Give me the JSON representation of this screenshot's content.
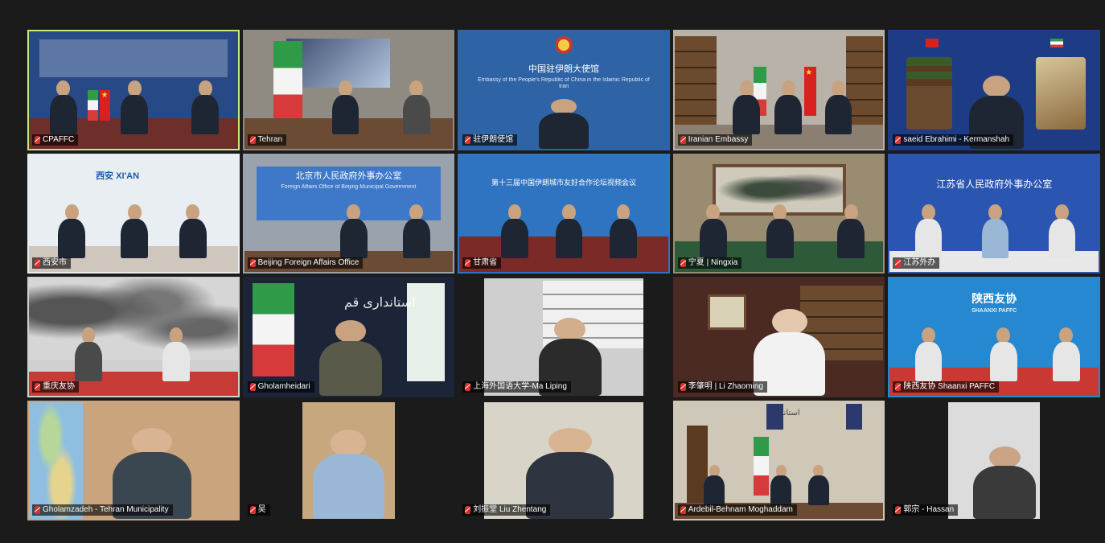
{
  "tiles": [
    {
      "label": "CPAFFC",
      "bg": "#274a86",
      "active": true
    },
    {
      "label": "Tehran",
      "bg": "#8f8a82"
    },
    {
      "label": "驻伊朗使馆",
      "bg": "#2e63a5",
      "sign_title": "中国驻伊朗大使馆",
      "sign_sub": "Embassy of the People's Republic of China in the Islamic Republic of Iran"
    },
    {
      "label": "Iranian Embassy",
      "bg": "#b8b2a8"
    },
    {
      "label": "saeid Ebrahimi - Kermanshah",
      "bg": "#1e3b86"
    },
    {
      "label": "西安市",
      "bg": "#e9eef2",
      "logo": "西安 XI'AN"
    },
    {
      "label": "Beijing Foreign Affairs Office",
      "bg": "#3e78c8",
      "sign_title": "北京市人民政府外事办公室",
      "sign_sub": "Foreign Affairs Office of Beijing Municipal Government"
    },
    {
      "label": "甘肃省",
      "bg": "#2f74c0",
      "sign_title": "第十三届中国伊朗城市友好合作论坛视频会议"
    },
    {
      "label": "宁夏 | Ningxia",
      "bg": "#9a8c70"
    },
    {
      "label": "江苏外办",
      "bg": "#2a55b0",
      "sign_title": "江苏省人民政府外事办公室"
    },
    {
      "label": "重庆友协",
      "bg": "#d0d0d0"
    },
    {
      "label": "Gholamheidari",
      "bg": "#1c2438"
    },
    {
      "label": "上海外国语大学-Ma Liping",
      "bg": "#1b1b1b"
    },
    {
      "label": "李肇明 | Li Zhaoming",
      "bg": "#4a2a22"
    },
    {
      "label": "陕西友协 Shaanxi PAFFC",
      "bg": "#2588d0",
      "sign_title": "陕西友协",
      "sign_sub": "SHAANXI PAFFC"
    },
    {
      "label": "Gholamzadeh - Tehran Municipality",
      "bg": "#c9a47c"
    },
    {
      "label": "吴",
      "bg": "#c7a77e"
    },
    {
      "label": "刘振堂 Liu Zhentang",
      "bg": "#d9d4c8"
    },
    {
      "label": "Ardebil-Behnam Moghaddam",
      "bg": "#cfc7b8"
    },
    {
      "label": "郭宗 - Hassan",
      "bg": "#dcdcdc"
    }
  ],
  "colors": {
    "active_border": "#cbe87a",
    "muted_mic": "#e0302b"
  }
}
